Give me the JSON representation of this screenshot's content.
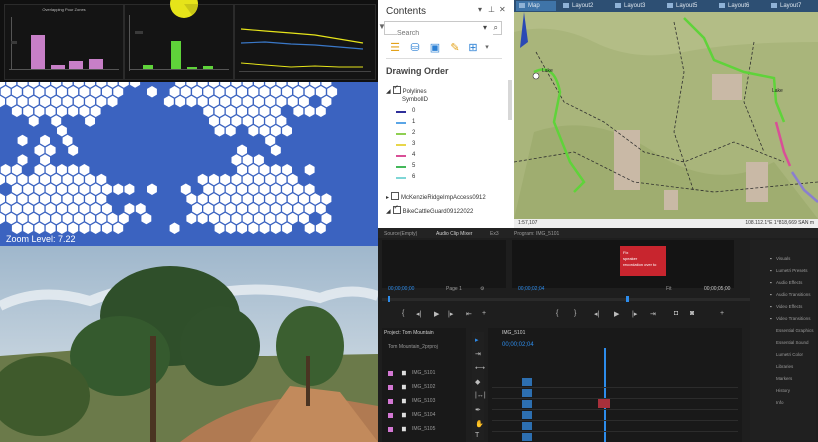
{
  "colors": {
    "hex_ocean": "#3b63c0",
    "hex_land": "#ffffff",
    "map_bg": "#a8b478",
    "trail_green": "#5fd33a",
    "premiere_blue": "#2d8ceb",
    "clip_red": "#c8252e"
  },
  "contents": {
    "title": "Contents",
    "search_placeholder": "Search",
    "section": "Drawing Order",
    "polylines_layer": "Polylines",
    "symbol_field": "SymbolID",
    "symbols": [
      {
        "label": "0",
        "color": "#2f2f9a"
      },
      {
        "label": "1",
        "color": "#5aa5e6"
      },
      {
        "label": "2",
        "color": "#8fcf52"
      },
      {
        "label": "3",
        "color": "#e8d64a"
      },
      {
        "label": "4",
        "color": "#d94f97"
      },
      {
        "label": "5",
        "color": "#44b85a"
      },
      {
        "label": "6",
        "color": "#7fd6d6"
      }
    ],
    "layer2": "McKenzieRidgeImpAccess0912",
    "layer3": "BikeCattleGuard09122022",
    "icons": [
      "list-by-drawing-order-icon",
      "list-by-source-icon",
      "list-by-selection-icon",
      "list-by-editing-icon",
      "list-by-snapping-icon"
    ]
  },
  "map": {
    "tabs": [
      "Map",
      "Layout2",
      "Layout3",
      "Layout5",
      "Layout6",
      "Layout7"
    ],
    "scale": "1:57,107",
    "coords": "108.112.1°E 1°818,669 SAN m"
  },
  "dashboard": {
    "chart_title": "Overlapping Pour Zones"
  },
  "hexmap": {
    "zoom_label": "Zoom Level: 7.22"
  },
  "premiere": {
    "source_tab": "Source(Empty)",
    "audio_tab": "Audio Clip Mixer",
    "effects_tab": "Ex3",
    "program_tab": "Program: IMG_5101",
    "source_tc_left": "00;00;00;00",
    "source_tc_right": "00;00;00;00",
    "program_tc_left": "00;00;02;04",
    "program_tc_right": "00;00;05;00",
    "page": "Page 1",
    "project_tab": "Project: Tom Mountain",
    "project_search": "Tom Mountain_2prproj",
    "timeline_tab": "IMG_5101",
    "timeline_tc": "00;00;02;04",
    "clip_note": "Fix\nspeaker\nrecordation over to",
    "files": [
      "IMG_5101",
      "IMG_5102",
      "IMG_5103",
      "IMG_5104",
      "IMG_5105"
    ],
    "right_panel": [
      "Visuals",
      "Lumetri Presets",
      "Audio Effects",
      "Audio Transitions",
      "Video Effects",
      "Video Transitions",
      "Essential Graphics",
      "Essential Sound",
      "Lumetri Color",
      "Libraries",
      "Markers",
      "History",
      "Info"
    ]
  }
}
